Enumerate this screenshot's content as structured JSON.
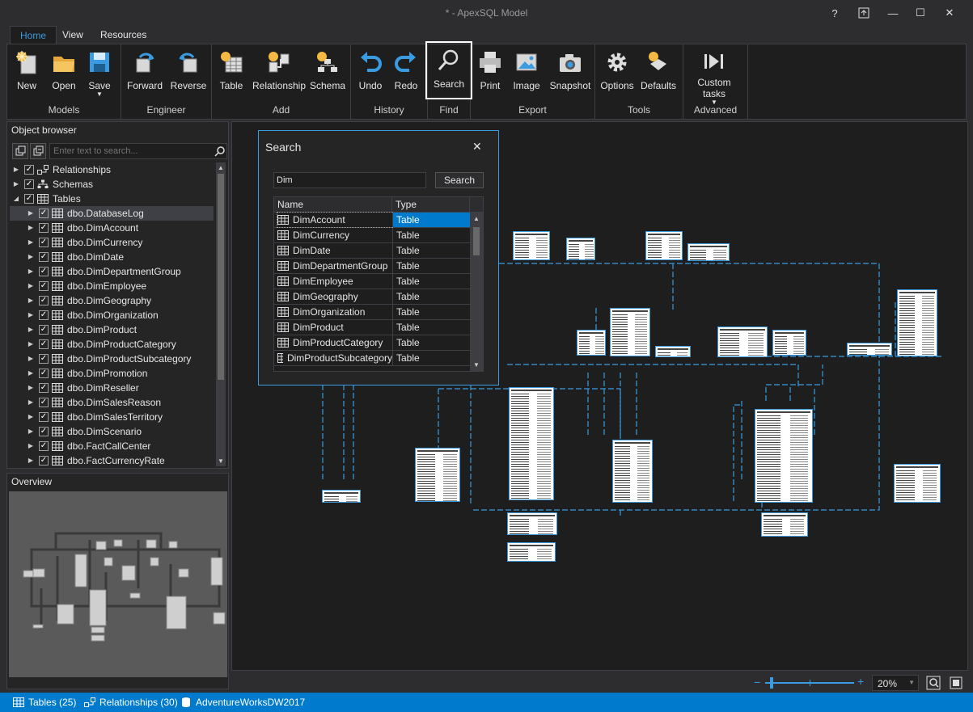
{
  "app": {
    "title": "* - ApexSQL Model"
  },
  "window_buttons": {
    "help": "?",
    "minimize": "—",
    "maximize": "☐",
    "close": "✕"
  },
  "tabs": [
    {
      "label": "Home"
    },
    {
      "label": "View"
    },
    {
      "label": "Resources"
    }
  ],
  "ribbon": {
    "groups": [
      {
        "name": "Models",
        "buttons": [
          {
            "label": "New"
          },
          {
            "label": "Open"
          },
          {
            "label": "Save"
          }
        ]
      },
      {
        "name": "Engineer",
        "buttons": [
          {
            "label": "Forward"
          },
          {
            "label": "Reverse"
          }
        ]
      },
      {
        "name": "Add",
        "buttons": [
          {
            "label": "Table"
          },
          {
            "label": "Relationship"
          },
          {
            "label": "Schema"
          }
        ]
      },
      {
        "name": "History",
        "buttons": [
          {
            "label": "Undo"
          },
          {
            "label": "Redo"
          }
        ]
      },
      {
        "name": "Find",
        "buttons": [
          {
            "label": "Search"
          }
        ]
      },
      {
        "name": "Export",
        "buttons": [
          {
            "label": "Print"
          },
          {
            "label": "Image"
          },
          {
            "label": "Snapshot"
          }
        ]
      },
      {
        "name": "Tools",
        "buttons": [
          {
            "label": "Options"
          },
          {
            "label": "Defaults"
          }
        ]
      },
      {
        "name": "Advanced",
        "buttons": [
          {
            "label": "Custom",
            "label2": "tasks"
          }
        ]
      }
    ]
  },
  "object_browser": {
    "title": "Object browser",
    "search_placeholder": "Enter text to search...",
    "tree": [
      {
        "label": "Relationships",
        "level": 0
      },
      {
        "label": "Schemas",
        "level": 0
      },
      {
        "label": "Tables",
        "level": 0
      },
      {
        "label": "dbo.DatabaseLog",
        "level": 1
      },
      {
        "label": "dbo.DimAccount",
        "level": 1
      },
      {
        "label": "dbo.DimCurrency",
        "level": 1
      },
      {
        "label": "dbo.DimDate",
        "level": 1
      },
      {
        "label": "dbo.DimDepartmentGroup",
        "level": 1
      },
      {
        "label": "dbo.DimEmployee",
        "level": 1
      },
      {
        "label": "dbo.DimGeography",
        "level": 1
      },
      {
        "label": "dbo.DimOrganization",
        "level": 1
      },
      {
        "label": "dbo.DimProduct",
        "level": 1
      },
      {
        "label": "dbo.DimProductCategory",
        "level": 1
      },
      {
        "label": "dbo.DimProductSubcategory",
        "level": 1
      },
      {
        "label": "dbo.DimPromotion",
        "level": 1
      },
      {
        "label": "dbo.DimReseller",
        "level": 1
      },
      {
        "label": "dbo.DimSalesReason",
        "level": 1
      },
      {
        "label": "dbo.DimSalesTerritory",
        "level": 1
      },
      {
        "label": "dbo.DimScenario",
        "level": 1
      },
      {
        "label": "dbo.FactCallCenter",
        "level": 1
      },
      {
        "label": "dbo.FactCurrencyRate",
        "level": 1
      }
    ]
  },
  "overview": {
    "title": "Overview"
  },
  "search_dialog": {
    "title": "Search",
    "query": "Dim",
    "button": "Search",
    "columns": [
      "Name",
      "Type"
    ],
    "rows": [
      {
        "name": "DimAccount",
        "type": "Table"
      },
      {
        "name": "DimCurrency",
        "type": "Table"
      },
      {
        "name": "DimDate",
        "type": "Table"
      },
      {
        "name": "DimDepartmentGroup",
        "type": "Table"
      },
      {
        "name": "DimEmployee",
        "type": "Table"
      },
      {
        "name": "DimGeography",
        "type": "Table"
      },
      {
        "name": "DimOrganization",
        "type": "Table"
      },
      {
        "name": "DimProduct",
        "type": "Table"
      },
      {
        "name": "DimProductCategory",
        "type": "Table"
      },
      {
        "name": "DimProductSubcategory",
        "type": "Table"
      }
    ]
  },
  "zoom": {
    "value": "20%"
  },
  "status": {
    "tables": "Tables (25)",
    "relationships": "Relationships (30)",
    "database": "AdventureWorksDW2017"
  },
  "colors": {
    "accent": "#007acc",
    "background": "#2d2d30",
    "canvas": "#1e1e1e",
    "relationship_line": "#3a9be0"
  }
}
